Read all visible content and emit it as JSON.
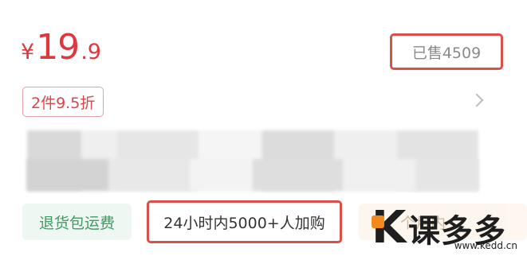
{
  "price": {
    "currency": "¥",
    "integer": "19",
    "decimal": ".9"
  },
  "sold": {
    "label": "已售4509"
  },
  "discount": {
    "label": "2件9.5折"
  },
  "tags": {
    "return_shipping": "退货包运费",
    "cart_count": "24小时内5000+人加购",
    "third": "个月内"
  },
  "watermark": {
    "text": "课多多",
    "url": "www.kedd.cn"
  },
  "icons": {
    "chevron": "chevron-right-icon"
  },
  "colors": {
    "price": "#e0373d",
    "highlight_border": "#d9504a",
    "green": "#3f9a63"
  }
}
